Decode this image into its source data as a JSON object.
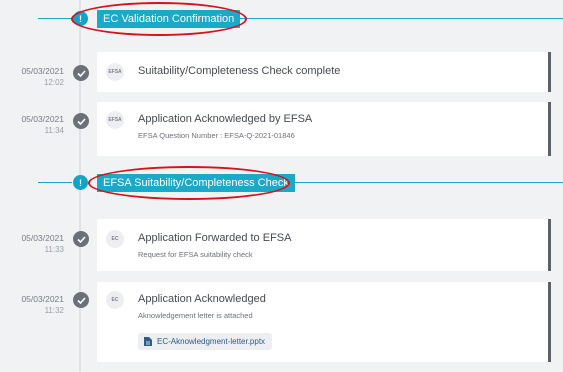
{
  "sections": [
    {
      "number": "!",
      "label": "EC Validation Confirmation"
    },
    {
      "number": "!",
      "label": "EFSA Suitability/Completeness Check"
    }
  ],
  "events": [
    {
      "date": "05/03/2021",
      "time": "12:02",
      "badge": "EFSA",
      "title": "Suitability/Completeness Check complete",
      "subtitle": ""
    },
    {
      "date": "05/03/2021",
      "time": "11:34",
      "badge": "EFSA",
      "title": "Application Acknowledged by EFSA",
      "subtitle": "EFSA Question Number : EFSA-Q-2021-01846"
    },
    {
      "date": "05/03/2021",
      "time": "11:33",
      "badge": "EC",
      "title": "Application Forwarded to EFSA",
      "subtitle": "Request for EFSA suitability check"
    },
    {
      "date": "05/03/2021",
      "time": "11:32",
      "badge": "EC",
      "title": "Application Acknowledged",
      "subtitle": "Aknowledgement letter is attached",
      "attachment": "EC-Aknowledgment-letter.pptx"
    }
  ],
  "colors": {
    "accent": "#1aa9c9",
    "highlight": "#d4141c",
    "check": "#6b7079"
  },
  "icons": {
    "check": "check-icon",
    "file": "file-icon"
  }
}
